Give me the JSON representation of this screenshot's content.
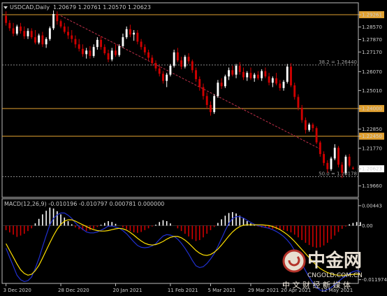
{
  "header": {
    "title": "USDCAD,Daily",
    "ohlc": "1.20679 1.20761 1.20570 1.20623"
  },
  "colors": {
    "background": "#000000",
    "bull_body": "#ffffff",
    "bear_body": "#d00000",
    "level_line": "#e0a030",
    "trend_line": "#c0304a",
    "fib_line": "#888888",
    "signal_line": "#ffe000",
    "macd_line": "#2030d0"
  },
  "chart_data": [
    {
      "type": "candlestick",
      "symbol": "USDCAD",
      "timeframe": "Daily",
      "ylim": [
        1.191,
        1.2985
      ],
      "price_ticks": [
        "1.29261",
        "1.28570",
        "1.27870",
        "1.27170",
        "1.26070",
        "1.25010",
        "1.24000",
        "1.22850",
        "1.22450",
        "1.21770",
        "1.20623",
        "1.19660"
      ],
      "x_ticks": [
        "3 Dec 2020",
        "28 Dec 2020",
        "20 Jan 2021",
        "11 Feb 2021",
        "5 Mar 2021",
        "29 Mar 2021",
        "20 Apr 2021",
        "12 May 2021"
      ],
      "current_price": 1.20623,
      "horizontal_levels": [
        {
          "value": 1.29261,
          "label": "1.29261"
        },
        {
          "value": 1.24,
          "label": "1.24000"
        },
        {
          "value": 1.2245,
          "label": "1.22450"
        }
      ],
      "fibonacci": [
        {
          "label": "38.2 = 1.26440",
          "value": 1.2644
        },
        {
          "label": "50.0 = 1.20178",
          "value": 1.20178
        }
      ],
      "trendline": {
        "start": [
          "28 Dec 2020",
          1.292
        ],
        "end": [
          "18 May 2021",
          1.217
        ]
      },
      "candles": [
        {
          "x": "3 Dec 2020",
          "o": 1.292,
          "h": 1.2945,
          "l": 1.2865,
          "c": 1.288
        },
        {
          "o": 1.288,
          "h": 1.2895,
          "l": 1.2835,
          "c": 1.285
        },
        {
          "o": 1.285,
          "h": 1.288,
          "l": 1.2805,
          "c": 1.282
        },
        {
          "o": 1.282,
          "h": 1.287,
          "l": 1.281,
          "c": 1.286
        },
        {
          "o": 1.286,
          "h": 1.288,
          "l": 1.282,
          "c": 1.2835
        },
        {
          "o": 1.2835,
          "h": 1.286,
          "l": 1.279,
          "c": 1.2805
        },
        {
          "o": 1.2805,
          "h": 1.285,
          "l": 1.279,
          "c": 1.2835
        },
        {
          "o": 1.2835,
          "h": 1.285,
          "l": 1.279,
          "c": 1.28
        },
        {
          "o": 1.28,
          "h": 1.284,
          "l": 1.276,
          "c": 1.277
        },
        {
          "o": 1.277,
          "h": 1.282,
          "l": 1.276,
          "c": 1.281
        },
        {
          "o": 1.281,
          "h": 1.283,
          "l": 1.2745,
          "c": 1.276
        },
        {
          "o": 1.276,
          "h": 1.28,
          "l": 1.274,
          "c": 1.279
        },
        {
          "o": 1.279,
          "h": 1.286,
          "l": 1.278,
          "c": 1.285
        },
        {
          "o": 1.285,
          "h": 1.295,
          "l": 1.284,
          "c": 1.293
        },
        {
          "o": 1.293,
          "h": 1.2945,
          "l": 1.287,
          "c": 1.289
        },
        {
          "x": "28 Dec 2020",
          "o": 1.289,
          "h": 1.29,
          "l": 1.285,
          "c": 1.286
        },
        {
          "o": 1.286,
          "h": 1.288,
          "l": 1.282,
          "c": 1.283
        },
        {
          "o": 1.283,
          "h": 1.286,
          "l": 1.279,
          "c": 1.281
        },
        {
          "o": 1.281,
          "h": 1.284,
          "l": 1.277,
          "c": 1.279
        },
        {
          "o": 1.279,
          "h": 1.281,
          "l": 1.274,
          "c": 1.276
        },
        {
          "o": 1.276,
          "h": 1.279,
          "l": 1.272,
          "c": 1.2735
        },
        {
          "o": 1.2735,
          "h": 1.276,
          "l": 1.269,
          "c": 1.2705
        },
        {
          "o": 1.2705,
          "h": 1.274,
          "l": 1.268,
          "c": 1.2725
        },
        {
          "o": 1.2725,
          "h": 1.275,
          "l": 1.268,
          "c": 1.2695
        },
        {
          "o": 1.2695,
          "h": 1.276,
          "l": 1.2685,
          "c": 1.2745
        },
        {
          "o": 1.2745,
          "h": 1.28,
          "l": 1.273,
          "c": 1.2785
        },
        {
          "o": 1.2785,
          "h": 1.2805,
          "l": 1.273,
          "c": 1.2745
        },
        {
          "o": 1.2745,
          "h": 1.276,
          "l": 1.27,
          "c": 1.271
        },
        {
          "o": 1.271,
          "h": 1.273,
          "l": 1.266,
          "c": 1.2675
        },
        {
          "o": 1.2675,
          "h": 1.274,
          "l": 1.2665,
          "c": 1.2725
        },
        {
          "x": "20 Jan 2021",
          "o": 1.2725,
          "h": 1.276,
          "l": 1.269,
          "c": 1.27
        },
        {
          "o": 1.27,
          "h": 1.276,
          "l": 1.269,
          "c": 1.275
        },
        {
          "o": 1.275,
          "h": 1.282,
          "l": 1.274,
          "c": 1.28
        },
        {
          "o": 1.28,
          "h": 1.286,
          "l": 1.279,
          "c": 1.2845
        },
        {
          "o": 1.2845,
          "h": 1.287,
          "l": 1.28,
          "c": 1.2815
        },
        {
          "o": 1.2815,
          "h": 1.284,
          "l": 1.278,
          "c": 1.2825
        },
        {
          "o": 1.2825,
          "h": 1.284,
          "l": 1.276,
          "c": 1.2775
        },
        {
          "o": 1.2775,
          "h": 1.279,
          "l": 1.273,
          "c": 1.2745
        },
        {
          "o": 1.2745,
          "h": 1.276,
          "l": 1.27,
          "c": 1.2715
        },
        {
          "o": 1.2715,
          "h": 1.273,
          "l": 1.267,
          "c": 1.2685
        },
        {
          "o": 1.2685,
          "h": 1.27,
          "l": 1.264,
          "c": 1.2655
        },
        {
          "o": 1.2655,
          "h": 1.267,
          "l": 1.261,
          "c": 1.2625
        },
        {
          "o": 1.2625,
          "h": 1.264,
          "l": 1.258,
          "c": 1.2595
        },
        {
          "o": 1.2595,
          "h": 1.261,
          "l": 1.254,
          "c": 1.2555
        },
        {
          "o": 1.2555,
          "h": 1.26,
          "l": 1.252,
          "c": 1.259
        },
        {
          "x": "11 Feb 2021",
          "o": 1.259,
          "h": 1.265,
          "l": 1.258,
          "c": 1.264
        },
        {
          "o": 1.264,
          "h": 1.273,
          "l": 1.263,
          "c": 1.2715
        },
        {
          "o": 1.2715,
          "h": 1.274,
          "l": 1.266,
          "c": 1.267
        },
        {
          "o": 1.267,
          "h": 1.269,
          "l": 1.262,
          "c": 1.2635
        },
        {
          "o": 1.2635,
          "h": 1.27,
          "l": 1.2625,
          "c": 1.269
        },
        {
          "o": 1.269,
          "h": 1.271,
          "l": 1.265,
          "c": 1.2665
        },
        {
          "o": 1.2665,
          "h": 1.2675,
          "l": 1.26,
          "c": 1.2615
        },
        {
          "o": 1.2615,
          "h": 1.263,
          "l": 1.255,
          "c": 1.2565
        },
        {
          "o": 1.2565,
          "h": 1.258,
          "l": 1.25,
          "c": 1.252
        },
        {
          "o": 1.252,
          "h": 1.254,
          "l": 1.245,
          "c": 1.247
        },
        {
          "o": 1.247,
          "h": 1.249,
          "l": 1.24,
          "c": 1.242
        },
        {
          "x": "5 Mar 2021",
          "o": 1.242,
          "h": 1.244,
          "l": 1.236,
          "c": 1.238
        },
        {
          "o": 1.238,
          "h": 1.248,
          "l": 1.237,
          "c": 1.247
        },
        {
          "o": 1.247,
          "h": 1.256,
          "l": 1.246,
          "c": 1.2545
        },
        {
          "o": 1.2545,
          "h": 1.257,
          "l": 1.251,
          "c": 1.2525
        },
        {
          "o": 1.2525,
          "h": 1.259,
          "l": 1.2515,
          "c": 1.258
        },
        {
          "o": 1.258,
          "h": 1.263,
          "l": 1.256,
          "c": 1.2615
        },
        {
          "o": 1.2615,
          "h": 1.264,
          "l": 1.258,
          "c": 1.259
        },
        {
          "o": 1.259,
          "h": 1.265,
          "l": 1.257,
          "c": 1.264
        },
        {
          "o": 1.264,
          "h": 1.266,
          "l": 1.259,
          "c": 1.2605
        },
        {
          "o": 1.2605,
          "h": 1.263,
          "l": 1.256,
          "c": 1.2575
        },
        {
          "o": 1.2575,
          "h": 1.261,
          "l": 1.2555,
          "c": 1.26
        },
        {
          "x": "29 Mar 2021",
          "o": 1.26,
          "h": 1.263,
          "l": 1.256,
          "c": 1.257
        },
        {
          "o": 1.257,
          "h": 1.26,
          "l": 1.255,
          "c": 1.259
        },
        {
          "o": 1.259,
          "h": 1.261,
          "l": 1.256,
          "c": 1.257
        },
        {
          "o": 1.257,
          "h": 1.262,
          "l": 1.2555,
          "c": 1.261
        },
        {
          "o": 1.261,
          "h": 1.263,
          "l": 1.257,
          "c": 1.258
        },
        {
          "o": 1.258,
          "h": 1.26,
          "l": 1.253,
          "c": 1.2545
        },
        {
          "o": 1.2545,
          "h": 1.258,
          "l": 1.252,
          "c": 1.257
        },
        {
          "o": 1.257,
          "h": 1.26,
          "l": 1.253,
          "c": 1.254
        },
        {
          "o": 1.254,
          "h": 1.256,
          "l": 1.25,
          "c": 1.2515
        },
        {
          "x": "20 Apr 2021",
          "o": 1.2515,
          "h": 1.256,
          "l": 1.25,
          "c": 1.255
        },
        {
          "o": 1.255,
          "h": 1.265,
          "l": 1.254,
          "c": 1.2635
        },
        {
          "o": 1.2635,
          "h": 1.2655,
          "l": 1.252,
          "c": 1.253
        },
        {
          "o": 1.253,
          "h": 1.2545,
          "l": 1.245,
          "c": 1.2465
        },
        {
          "o": 1.2465,
          "h": 1.248,
          "l": 1.239,
          "c": 1.2405
        },
        {
          "o": 1.2405,
          "h": 1.242,
          "l": 1.232,
          "c": 1.2335
        },
        {
          "o": 1.2335,
          "h": 1.235,
          "l": 1.226,
          "c": 1.228
        },
        {
          "o": 1.228,
          "h": 1.232,
          "l": 1.227,
          "c": 1.231
        },
        {
          "o": 1.231,
          "h": 1.232,
          "l": 1.227,
          "c": 1.229
        },
        {
          "o": 1.229,
          "h": 1.23,
          "l": 1.22,
          "c": 1.221
        },
        {
          "o": 1.221,
          "h": 1.222,
          "l": 1.213,
          "c": 1.2145
        },
        {
          "x": "12 May 2021",
          "o": 1.2145,
          "h": 1.216,
          "l": 1.208,
          "c": 1.2095
        },
        {
          "o": 1.2095,
          "h": 1.211,
          "l": 1.204,
          "c": 1.206
        },
        {
          "o": 1.206,
          "h": 1.213,
          "l": 1.205,
          "c": 1.212
        },
        {
          "o": 1.212,
          "h": 1.22,
          "l": 1.211,
          "c": 1.218
        },
        {
          "o": 1.218,
          "h": 1.219,
          "l": 1.207,
          "c": 1.2085
        },
        {
          "o": 1.2085,
          "h": 1.21,
          "l": 1.201,
          "c": 1.204
        },
        {
          "o": 1.204,
          "h": 1.214,
          "l": 1.203,
          "c": 1.213
        },
        {
          "o": 1.213,
          "h": 1.2145,
          "l": 1.207,
          "c": 1.208
        },
        {
          "o": 1.2068,
          "h": 1.2076,
          "l": 1.2057,
          "c": 1.2062
        }
      ]
    },
    {
      "type": "macd",
      "title": "MACD(12,26,9) -0.010196 -0.010797 0.000781 0.000000",
      "params": [
        12,
        26,
        9
      ],
      "values": {
        "main": -0.010196,
        "signal": -0.010797,
        "histogram": 0.000781,
        "zero": 0.0
      },
      "ylim": [
        -0.0125,
        0.0055
      ],
      "ticks": [
        "0.00443",
        "0.00",
        "-0.011974"
      ],
      "histogram": [
        -0.001,
        -0.0015,
        -0.002,
        -0.0025,
        -0.0022,
        -0.0018,
        -0.0012,
        -0.0006,
        0.0005,
        0.0015,
        0.0025,
        0.0033,
        0.004,
        0.0038,
        0.0032,
        0.0025,
        0.0018,
        0.001,
        0.0003,
        -0.0004,
        -0.0008,
        -0.001,
        -0.0012,
        -0.001,
        -0.0007,
        -0.0003,
        0.0002,
        0.0006,
        0.001,
        0.0008,
        0.0004,
        0.0,
        -0.0004,
        -0.0008,
        -0.0012,
        -0.0015,
        -0.0016,
        -0.0014,
        -0.001,
        -0.0006,
        -0.0002,
        0.0002,
        0.0008,
        0.0012,
        0.001,
        0.0005,
        0.0,
        -0.0006,
        -0.0012,
        -0.0018,
        -0.0024,
        -0.003,
        -0.0034,
        -0.0032,
        -0.0026,
        -0.0018,
        -0.001,
        -0.0003,
        0.0006,
        0.0014,
        0.0022,
        0.0028,
        0.003,
        0.0027,
        0.0022,
        0.0016,
        0.001,
        0.0005,
        0.0001,
        -0.0002,
        -0.0004,
        -0.0005,
        -0.0006,
        -0.0007,
        -0.0008,
        -0.0009,
        -0.001,
        -0.0012,
        -0.0015,
        -0.002,
        -0.0026,
        -0.0032,
        -0.0038,
        -0.0043,
        -0.0047,
        -0.0049,
        -0.0048,
        -0.0044,
        -0.0038,
        -0.003,
        -0.0022,
        -0.0014,
        -0.0007,
        -0.0002,
        0.0003,
        0.0006,
        0.0008,
        0.00078
      ],
      "signal": [
        -0.004,
        -0.0055,
        -0.007,
        -0.0085,
        -0.0098,
        -0.0106,
        -0.011,
        -0.0108,
        -0.01,
        -0.0088,
        -0.0072,
        -0.0055,
        -0.0038,
        -0.0022,
        -0.0008,
        0.0003,
        0.001,
        0.0013,
        0.0013,
        0.001,
        0.0006,
        0.0002,
        -0.0002,
        -0.0006,
        -0.0009,
        -0.0011,
        -0.0012,
        -0.0012,
        -0.0011,
        -0.0009,
        -0.0007,
        -0.0006,
        -0.0007,
        -0.001,
        -0.0015,
        -0.0021,
        -0.0028,
        -0.0034,
        -0.0039,
        -0.0042,
        -0.0043,
        -0.0042,
        -0.0039,
        -0.0035,
        -0.003,
        -0.0026,
        -0.0024,
        -0.0024,
        -0.0027,
        -0.0032,
        -0.0039,
        -0.0047,
        -0.0055,
        -0.0061,
        -0.0065,
        -0.0066,
        -0.0064,
        -0.0059,
        -0.0052,
        -0.0043,
        -0.0033,
        -0.0023,
        -0.0014,
        -0.0007,
        -0.0002,
        0.0001,
        0.0002,
        0.0002,
        0.0002,
        0.0002,
        0.0002,
        0.0001,
        0.0,
        -0.0002,
        -0.0005,
        -0.0009,
        -0.0014,
        -0.002,
        -0.0027,
        -0.0035,
        -0.0044,
        -0.0053,
        -0.0062,
        -0.0071,
        -0.008,
        -0.0088,
        -0.0095,
        -0.01,
        -0.0104,
        -0.0107,
        -0.0109,
        -0.011,
        -0.011,
        -0.011,
        -0.0109,
        -0.0108,
        -0.0108,
        -0.010797
      ],
      "macd": [
        -0.005,
        -0.007,
        -0.009,
        -0.011,
        -0.012,
        -0.0124,
        -0.0122,
        -0.0114,
        -0.0095,
        -0.0073,
        -0.0047,
        -0.0022,
        0.0002,
        0.0016,
        0.0024,
        0.0028,
        0.0028,
        0.0023,
        0.0016,
        0.0006,
        -0.0002,
        -0.0008,
        -0.0014,
        -0.0016,
        -0.0016,
        -0.0014,
        -0.001,
        -0.0006,
        -0.0001,
        -0.0001,
        -0.0003,
        -0.0006,
        -0.0011,
        -0.0018,
        -0.0027,
        -0.0036,
        -0.0044,
        -0.0048,
        -0.0049,
        -0.0048,
        -0.0045,
        -0.004,
        -0.0031,
        -0.0023,
        -0.002,
        -0.0021,
        -0.0024,
        -0.003,
        -0.0039,
        -0.005,
        -0.0063,
        -0.0077,
        -0.0089,
        -0.0093,
        -0.0091,
        -0.0084,
        -0.0074,
        -0.0062,
        -0.0046,
        -0.0029,
        -0.0011,
        0.0005,
        0.0016,
        0.002,
        0.002,
        0.0017,
        0.0012,
        0.0007,
        0.0003,
        0.0,
        -0.0002,
        -0.0004,
        -0.0006,
        -0.0009,
        -0.0013,
        -0.0018,
        -0.0024,
        -0.0032,
        -0.0042,
        -0.0055,
        -0.007,
        -0.0085,
        -0.01,
        -0.0114,
        -0.0127,
        -0.0137,
        -0.0143,
        -0.0144,
        -0.0142,
        -0.0137,
        -0.0131,
        -0.0124,
        -0.0117,
        -0.0112,
        -0.0106,
        -0.0102,
        -0.01,
        -0.010196
      ]
    }
  ],
  "watermark": {
    "brand": "中金网",
    "domain": "CNGOLD.COM.CN",
    "tagline": "中 文 财 经 新 媒 体"
  }
}
